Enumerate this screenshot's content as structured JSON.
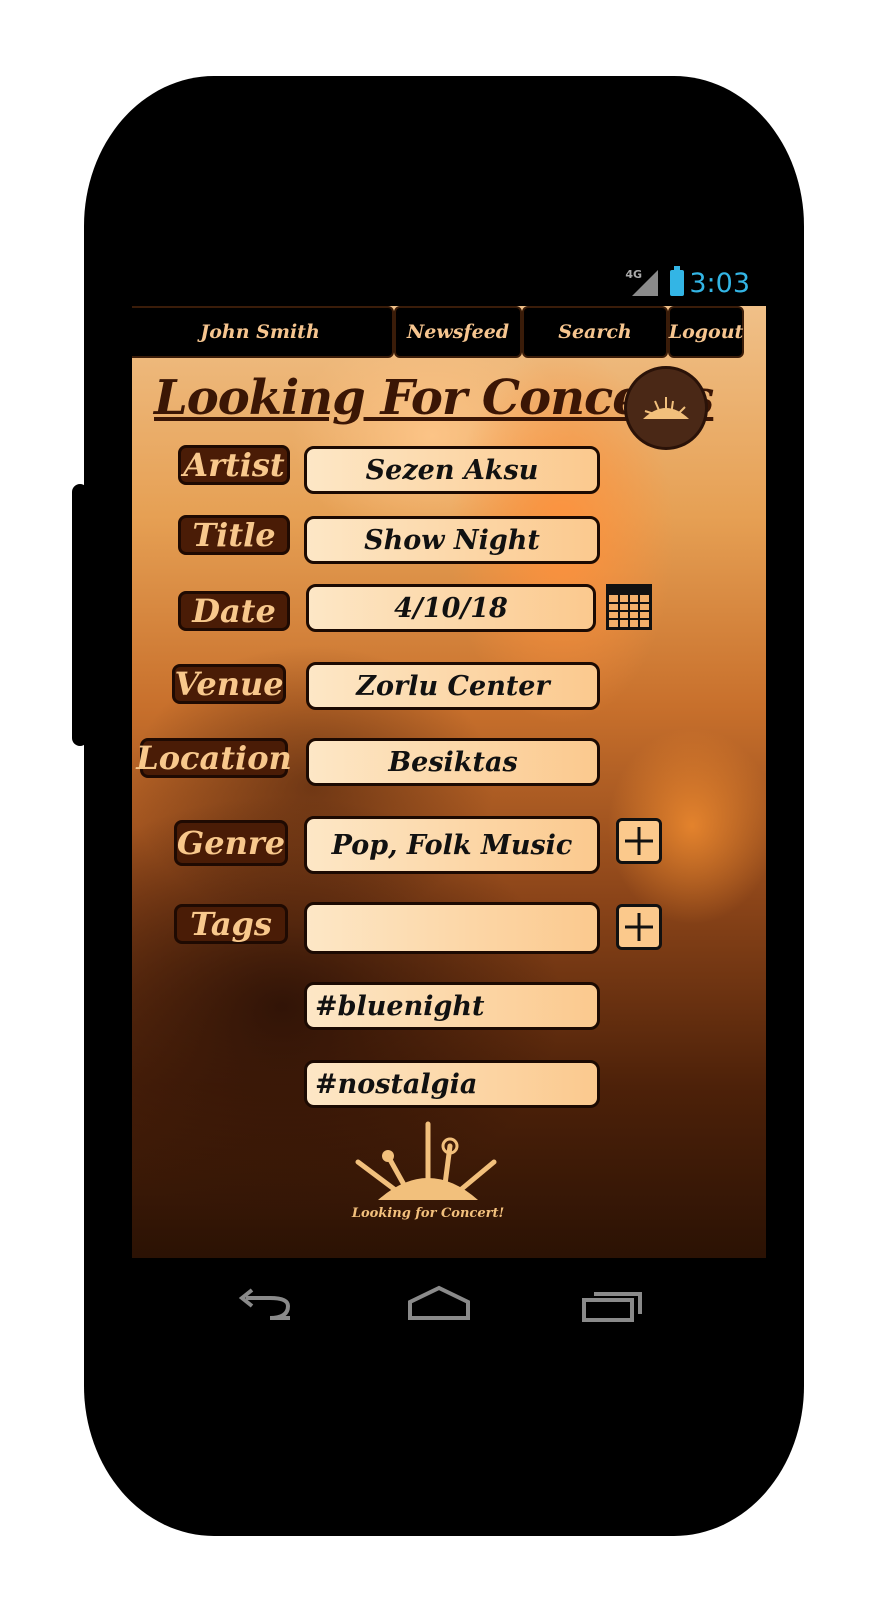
{
  "status_bar": {
    "network": "4G",
    "time": "3:03"
  },
  "nav": {
    "user": "John Smith",
    "newsfeed": "Newsfeed",
    "search": "Search",
    "logout": "Logout"
  },
  "page": {
    "title": "Looking For Concerts",
    "logo_caption": "Looking for Concert!"
  },
  "form": {
    "artist": {
      "label": "Artist",
      "value": "Sezen Aksu"
    },
    "title": {
      "label": "Title",
      "value": "Show Night"
    },
    "date": {
      "label": "Date",
      "value": "4/10/18"
    },
    "venue": {
      "label": "Venue",
      "value": "Zorlu Center"
    },
    "location": {
      "label": "Location",
      "value": "Besiktas"
    },
    "genre": {
      "label": "Genre",
      "value": "Pop, Folk Music"
    },
    "tags": {
      "label": "Tags",
      "value": "",
      "items": [
        "#bluenight",
        "#nostalgia"
      ]
    }
  },
  "colors": {
    "accent": "#33b5e5",
    "label_bg": "#4a1c06",
    "label_text": "#f8c88c",
    "field_bg": "#fbc98e"
  },
  "icons": [
    "calendar-icon",
    "plus-icon",
    "back-icon",
    "home-icon",
    "recents-icon",
    "battery-icon",
    "signal-icon"
  ]
}
